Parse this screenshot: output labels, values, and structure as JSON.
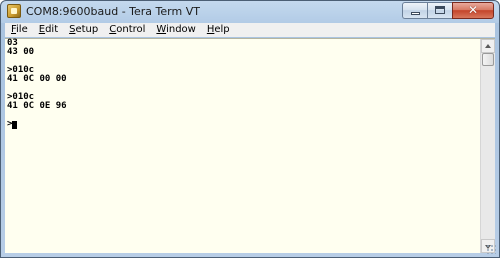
{
  "window": {
    "title": "COM8:9600baud - Tera Term VT",
    "icon": "tera-term-app-icon",
    "close_glyph": "✕"
  },
  "menubar": {
    "items": [
      {
        "accel": "F",
        "rest": "ile"
      },
      {
        "accel": "E",
        "rest": "dit"
      },
      {
        "accel": "S",
        "rest": "etup"
      },
      {
        "accel": "C",
        "rest": "ontrol"
      },
      {
        "accel": "W",
        "rest": "indow"
      },
      {
        "accel": "H",
        "rest": "elp"
      }
    ]
  },
  "terminal": {
    "lines": [
      "03",
      "43 00",
      "",
      ">010c",
      "41 0C 00 00",
      "",
      ">010c",
      "41 0C 0E 96",
      "",
      ">"
    ],
    "colors": {
      "background": "#fffff0",
      "foreground": "#000000"
    }
  }
}
